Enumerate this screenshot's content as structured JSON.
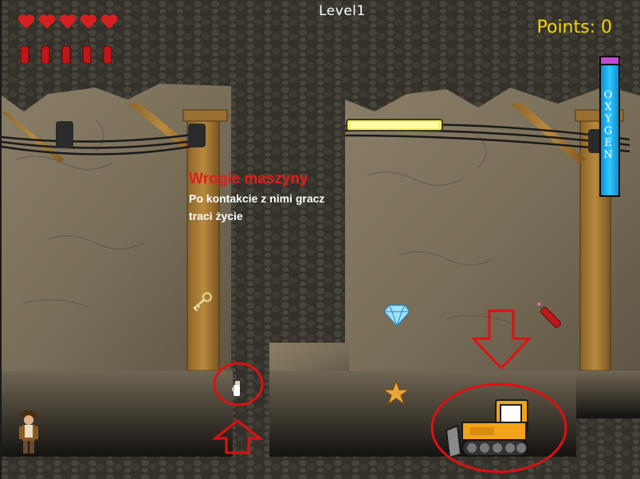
{
  "hud": {
    "level_label": "Level1",
    "points_label": "Points: 0",
    "lives": 5,
    "dynamite": 5,
    "oxygen_label": "OXYGEN",
    "oxygen_level": 1.0
  },
  "info": {
    "title": "Wrogie maszyny",
    "text": "Po kontakcie z nimi gracz traci życie"
  },
  "colors": {
    "heart": "#d42020",
    "dynamite": "#c0161a",
    "points": "#f5d400",
    "annotation": "#e01010",
    "oxygen": "#2ec7ff"
  },
  "sprites": [
    "key-icon",
    "diamond-icon",
    "dynamite-pickup-icon",
    "star-icon",
    "bulldozer-enemy",
    "small-enemy",
    "miner-player"
  ]
}
